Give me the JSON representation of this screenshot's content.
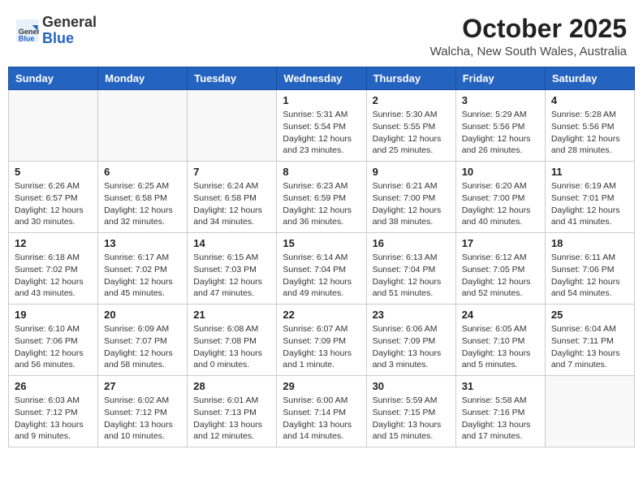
{
  "header": {
    "logo": {
      "general": "General",
      "blue": "Blue"
    },
    "title": "October 2025",
    "location": "Walcha, New South Wales, Australia"
  },
  "weekdays": [
    "Sunday",
    "Monday",
    "Tuesday",
    "Wednesday",
    "Thursday",
    "Friday",
    "Saturday"
  ],
  "weeks": [
    [
      {
        "day": "",
        "empty": true
      },
      {
        "day": "",
        "empty": true
      },
      {
        "day": "",
        "empty": true
      },
      {
        "day": "1",
        "sunrise": "Sunrise: 5:31 AM",
        "sunset": "Sunset: 5:54 PM",
        "daylight": "Daylight: 12 hours and 23 minutes."
      },
      {
        "day": "2",
        "sunrise": "Sunrise: 5:30 AM",
        "sunset": "Sunset: 5:55 PM",
        "daylight": "Daylight: 12 hours and 25 minutes."
      },
      {
        "day": "3",
        "sunrise": "Sunrise: 5:29 AM",
        "sunset": "Sunset: 5:56 PM",
        "daylight": "Daylight: 12 hours and 26 minutes."
      },
      {
        "day": "4",
        "sunrise": "Sunrise: 5:28 AM",
        "sunset": "Sunset: 5:56 PM",
        "daylight": "Daylight: 12 hours and 28 minutes."
      }
    ],
    [
      {
        "day": "5",
        "sunrise": "Sunrise: 6:26 AM",
        "sunset": "Sunset: 6:57 PM",
        "daylight": "Daylight: 12 hours and 30 minutes."
      },
      {
        "day": "6",
        "sunrise": "Sunrise: 6:25 AM",
        "sunset": "Sunset: 6:58 PM",
        "daylight": "Daylight: 12 hours and 32 minutes."
      },
      {
        "day": "7",
        "sunrise": "Sunrise: 6:24 AM",
        "sunset": "Sunset: 6:58 PM",
        "daylight": "Daylight: 12 hours and 34 minutes."
      },
      {
        "day": "8",
        "sunrise": "Sunrise: 6:23 AM",
        "sunset": "Sunset: 6:59 PM",
        "daylight": "Daylight: 12 hours and 36 minutes."
      },
      {
        "day": "9",
        "sunrise": "Sunrise: 6:21 AM",
        "sunset": "Sunset: 7:00 PM",
        "daylight": "Daylight: 12 hours and 38 minutes."
      },
      {
        "day": "10",
        "sunrise": "Sunrise: 6:20 AM",
        "sunset": "Sunset: 7:00 PM",
        "daylight": "Daylight: 12 hours and 40 minutes."
      },
      {
        "day": "11",
        "sunrise": "Sunrise: 6:19 AM",
        "sunset": "Sunset: 7:01 PM",
        "daylight": "Daylight: 12 hours and 41 minutes."
      }
    ],
    [
      {
        "day": "12",
        "sunrise": "Sunrise: 6:18 AM",
        "sunset": "Sunset: 7:02 PM",
        "daylight": "Daylight: 12 hours and 43 minutes."
      },
      {
        "day": "13",
        "sunrise": "Sunrise: 6:17 AM",
        "sunset": "Sunset: 7:02 PM",
        "daylight": "Daylight: 12 hours and 45 minutes."
      },
      {
        "day": "14",
        "sunrise": "Sunrise: 6:15 AM",
        "sunset": "Sunset: 7:03 PM",
        "daylight": "Daylight: 12 hours and 47 minutes."
      },
      {
        "day": "15",
        "sunrise": "Sunrise: 6:14 AM",
        "sunset": "Sunset: 7:04 PM",
        "daylight": "Daylight: 12 hours and 49 minutes."
      },
      {
        "day": "16",
        "sunrise": "Sunrise: 6:13 AM",
        "sunset": "Sunset: 7:04 PM",
        "daylight": "Daylight: 12 hours and 51 minutes."
      },
      {
        "day": "17",
        "sunrise": "Sunrise: 6:12 AM",
        "sunset": "Sunset: 7:05 PM",
        "daylight": "Daylight: 12 hours and 52 minutes."
      },
      {
        "day": "18",
        "sunrise": "Sunrise: 6:11 AM",
        "sunset": "Sunset: 7:06 PM",
        "daylight": "Daylight: 12 hours and 54 minutes."
      }
    ],
    [
      {
        "day": "19",
        "sunrise": "Sunrise: 6:10 AM",
        "sunset": "Sunset: 7:06 PM",
        "daylight": "Daylight: 12 hours and 56 minutes."
      },
      {
        "day": "20",
        "sunrise": "Sunrise: 6:09 AM",
        "sunset": "Sunset: 7:07 PM",
        "daylight": "Daylight: 12 hours and 58 minutes."
      },
      {
        "day": "21",
        "sunrise": "Sunrise: 6:08 AM",
        "sunset": "Sunset: 7:08 PM",
        "daylight": "Daylight: 13 hours and 0 minutes."
      },
      {
        "day": "22",
        "sunrise": "Sunrise: 6:07 AM",
        "sunset": "Sunset: 7:09 PM",
        "daylight": "Daylight: 13 hours and 1 minute."
      },
      {
        "day": "23",
        "sunrise": "Sunrise: 6:06 AM",
        "sunset": "Sunset: 7:09 PM",
        "daylight": "Daylight: 13 hours and 3 minutes."
      },
      {
        "day": "24",
        "sunrise": "Sunrise: 6:05 AM",
        "sunset": "Sunset: 7:10 PM",
        "daylight": "Daylight: 13 hours and 5 minutes."
      },
      {
        "day": "25",
        "sunrise": "Sunrise: 6:04 AM",
        "sunset": "Sunset: 7:11 PM",
        "daylight": "Daylight: 13 hours and 7 minutes."
      }
    ],
    [
      {
        "day": "26",
        "sunrise": "Sunrise: 6:03 AM",
        "sunset": "Sunset: 7:12 PM",
        "daylight": "Daylight: 13 hours and 9 minutes."
      },
      {
        "day": "27",
        "sunrise": "Sunrise: 6:02 AM",
        "sunset": "Sunset: 7:12 PM",
        "daylight": "Daylight: 13 hours and 10 minutes."
      },
      {
        "day": "28",
        "sunrise": "Sunrise: 6:01 AM",
        "sunset": "Sunset: 7:13 PM",
        "daylight": "Daylight: 13 hours and 12 minutes."
      },
      {
        "day": "29",
        "sunrise": "Sunrise: 6:00 AM",
        "sunset": "Sunset: 7:14 PM",
        "daylight": "Daylight: 13 hours and 14 minutes."
      },
      {
        "day": "30",
        "sunrise": "Sunrise: 5:59 AM",
        "sunset": "Sunset: 7:15 PM",
        "daylight": "Daylight: 13 hours and 15 minutes."
      },
      {
        "day": "31",
        "sunrise": "Sunrise: 5:58 AM",
        "sunset": "Sunset: 7:16 PM",
        "daylight": "Daylight: 13 hours and 17 minutes."
      },
      {
        "day": "",
        "empty": true
      }
    ]
  ]
}
